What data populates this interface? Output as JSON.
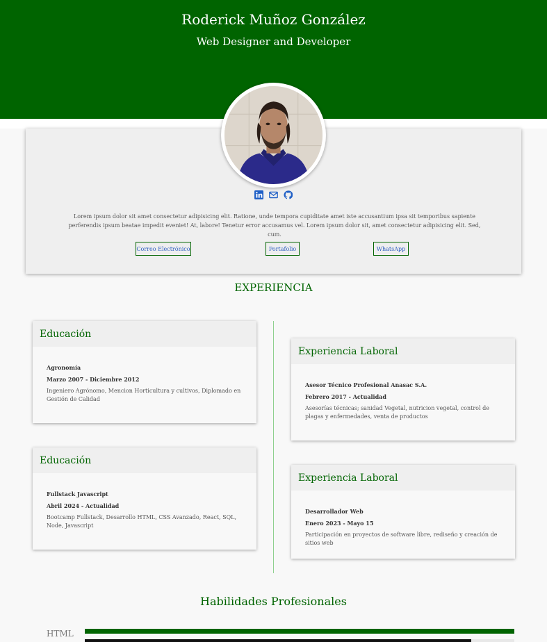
{
  "header": {
    "name": "Roderick Muñoz González",
    "title": "Web Designer and Developer",
    "background_color": "#006400"
  },
  "profile": {
    "avatar_alt": "profile photo",
    "socials": [
      {
        "icon": "linkedin-icon"
      },
      {
        "icon": "mail-icon"
      },
      {
        "icon": "github-icon"
      }
    ],
    "bio": "Lorem ipsum dolor sit amet consectetur adipisicing elit. Ratione, unde tempora cupiditate amet iste accusantium ipsa sit temporibus sapiente perferendis ipsum beatae impedit eveniet! At, labore! Tenetur error accusamus vel. Lorem ipsum dolor sit, amet consectetur adipisicing elit. Sed, cum.",
    "buttons": {
      "email": "Correo Electrónico",
      "portfolio": "Portafolio",
      "whatsapp": "WhatsApp"
    }
  },
  "experience": {
    "title": "EXPERIENCIA",
    "left": [
      {
        "heading": "Educación",
        "role": "Agronomía",
        "date": "Marzo 2007 - Diciembre 2012",
        "desc": "Ingeniero Agrónomo, Mencion Horticultura y cultivos, Diplomado en Gestión de Calidad"
      },
      {
        "heading": "Educación",
        "role": "Fullstack Javascript",
        "date": "Abril 2024 - Actualidad",
        "desc": "Bootcamp Fullstack, Desarrollo HTML, CSS Avanzado, React, SQL, Node, Javascript"
      }
    ],
    "right": [
      {
        "heading": "Experiencia Laboral",
        "role": "Asesor Técnico Profesional Anasac S.A.",
        "date": "Febrero 2017 - Actualidad",
        "desc": "Asesorías técnicas; sanidad Vegetal, nutricion vegetal, control de plagas y enfermedades, venta de productos"
      },
      {
        "heading": "Experiencia Laboral",
        "role": "Desarrollador Web",
        "date": "Enero 2023 - Mayo 15",
        "desc": "Participación en proyectos de software libre, rediseño y creación de sitios web"
      }
    ]
  },
  "skills": {
    "title": "Habilidades Profesionales",
    "items": [
      {
        "label": "HTML",
        "level": 1.0
      },
      {
        "label": "",
        "level": 0.9
      }
    ]
  },
  "colors": {
    "accent": "#006400",
    "timeline": "#8fd08f",
    "link": "#2f5fc2",
    "card_bg": "#efefef"
  }
}
